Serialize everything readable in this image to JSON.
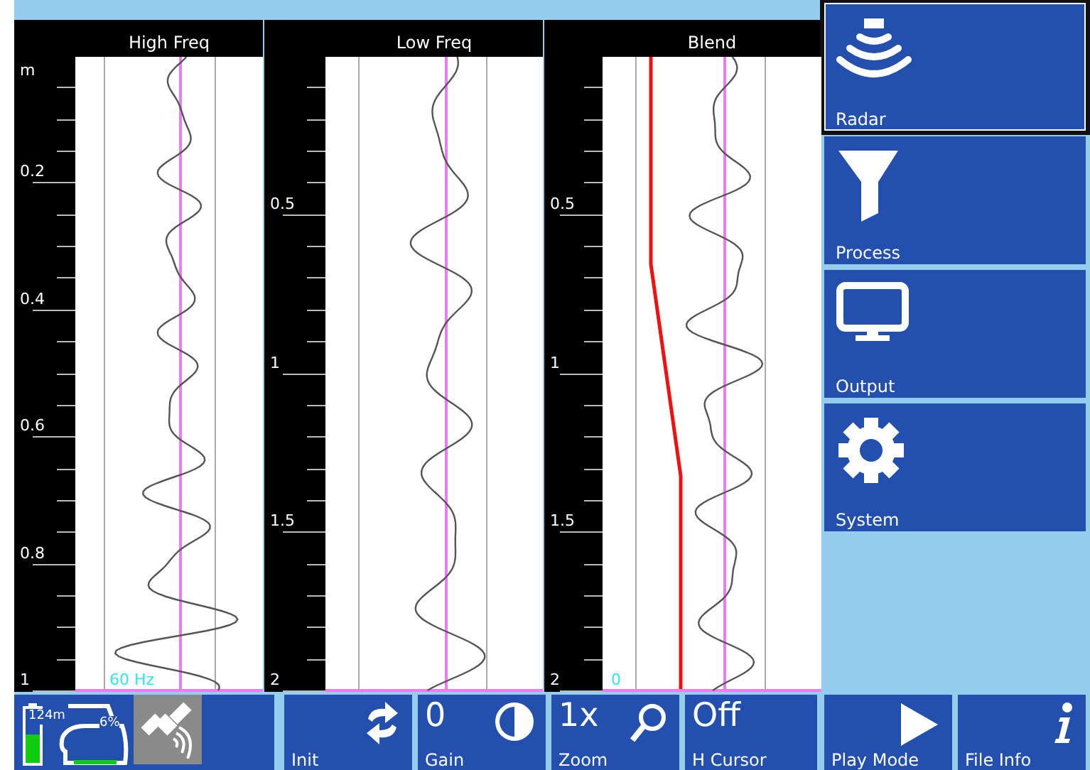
{
  "panels": [
    {
      "title": "High Freq",
      "kind": "high",
      "axis_unit": "m",
      "axis_labels": [
        "0.2",
        "0.4",
        "0.6",
        "0.8",
        "1"
      ],
      "overlay_label": "60 Hz",
      "blend_curve": false
    },
    {
      "title": "Low Freq",
      "kind": "low",
      "axis_labels": [
        "0.5",
        "1",
        "1.5",
        "2"
      ],
      "blend_curve": false
    },
    {
      "title": "Blend",
      "kind": "blend",
      "axis_labels": [
        "0.5",
        "1",
        "1.5",
        "2"
      ],
      "overlay_label": "0",
      "blend_curve": true
    }
  ],
  "menu": [
    {
      "label": "Radar",
      "kind": "radar",
      "selected": true
    },
    {
      "label": "Process",
      "kind": "process",
      "selected": false
    },
    {
      "label": "Output",
      "kind": "output",
      "selected": false
    },
    {
      "label": "System",
      "kind": "system",
      "selected": false
    }
  ],
  "status": {
    "battery_text": "124m",
    "storage_text": "6%"
  },
  "toolbar": [
    {
      "label": "Init",
      "kind": "init"
    },
    {
      "value": "0",
      "label": "Gain",
      "kind": "gain"
    },
    {
      "value": "1x",
      "label": "Zoom",
      "kind": "zoom"
    },
    {
      "value": "Off",
      "label": "H Cursor",
      "kind": "cursor"
    },
    {
      "label": "Play Mode",
      "kind": "play"
    },
    {
      "label": "File Info",
      "kind": "info"
    }
  ]
}
